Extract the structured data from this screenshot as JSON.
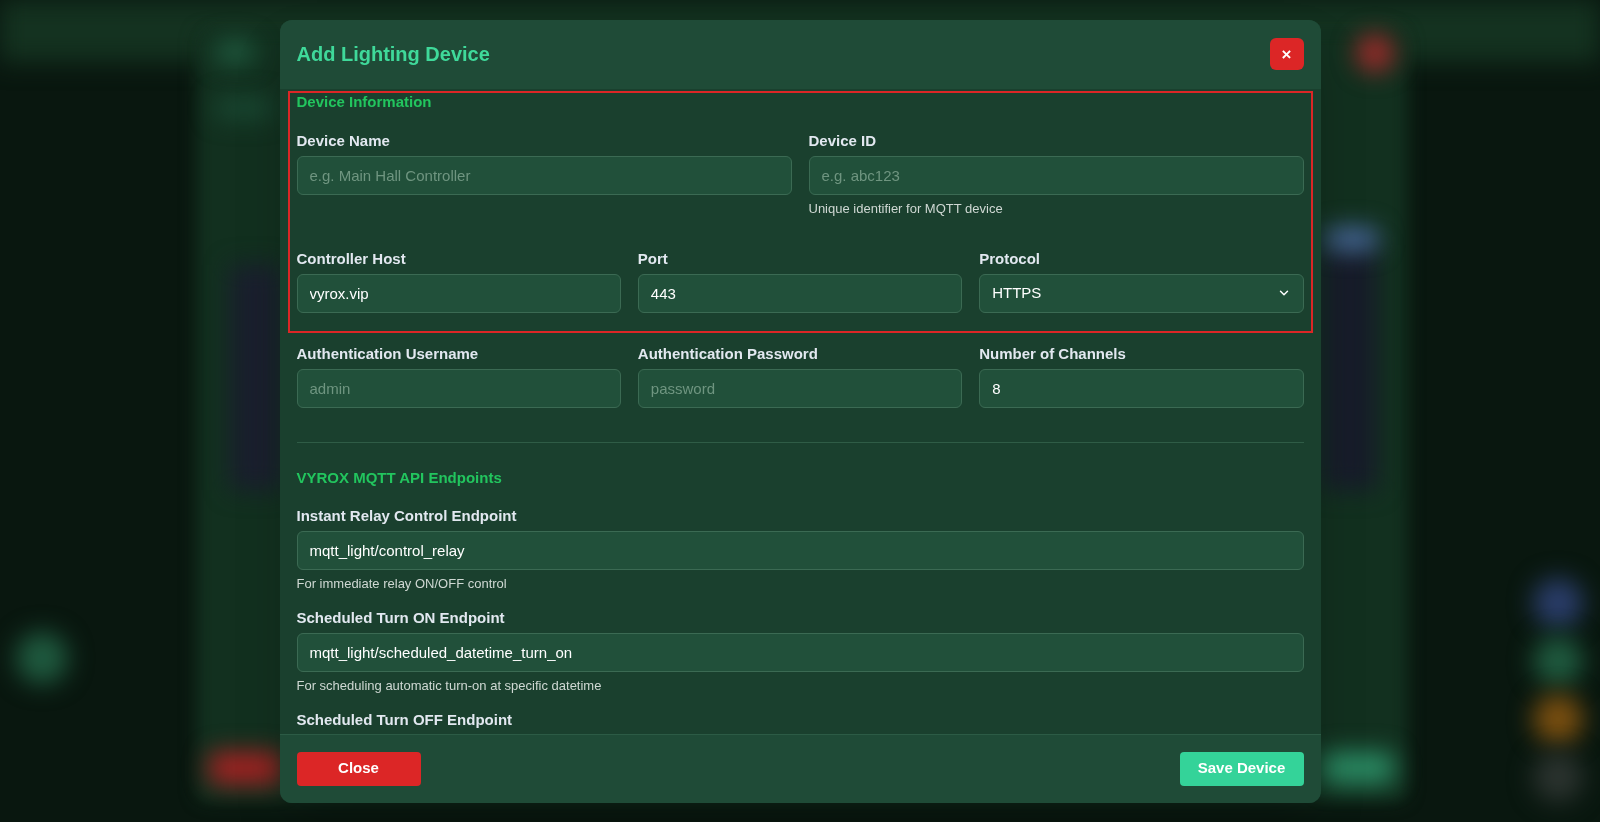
{
  "dialog": {
    "title": "Add Lighting Device",
    "close_label": "×"
  },
  "device_information": {
    "heading": "Device Information",
    "highlighted": true,
    "rows": [
      [
        {
          "kind": "text",
          "label": "Device Name",
          "placeholder": "e.g. Main Hall Controller"
        },
        {
          "kind": "text",
          "label": "Device ID",
          "placeholder": "e.g. abc123",
          "hint": "Unique identifier for MQTT device"
        }
      ],
      [
        {
          "kind": "text",
          "label": "Controller Host",
          "value": "vyrox.vip"
        },
        {
          "kind": "text",
          "label": "Port",
          "value": "443"
        },
        {
          "kind": "select",
          "label": "Protocol",
          "value": "HTTPS"
        }
      ]
    ]
  },
  "authentication": {
    "fields": [
      {
        "label": "Authentication Username",
        "placeholder": "admin"
      },
      {
        "label": "Authentication Password",
        "placeholder": "password"
      },
      {
        "label": "Number of Channels",
        "value": "8"
      }
    ]
  },
  "endpoints": {
    "heading": "VYROX MQTT API Endpoints",
    "fields": [
      {
        "label": "Instant Relay Control Endpoint",
        "value": "mqtt_light/control_relay",
        "hint": "For immediate relay ON/OFF control"
      },
      {
        "label": "Scheduled Turn ON Endpoint",
        "value": "mqtt_light/scheduled_datetime_turn_on",
        "hint": "For scheduling automatic turn-on at specific datetime"
      },
      {
        "label": "Scheduled Turn OFF Endpoint"
      }
    ]
  },
  "footer": {
    "buttons": [
      {
        "kind": "danger",
        "label": "Close"
      },
      {
        "kind": "primary",
        "label": "Save Device"
      }
    ]
  }
}
